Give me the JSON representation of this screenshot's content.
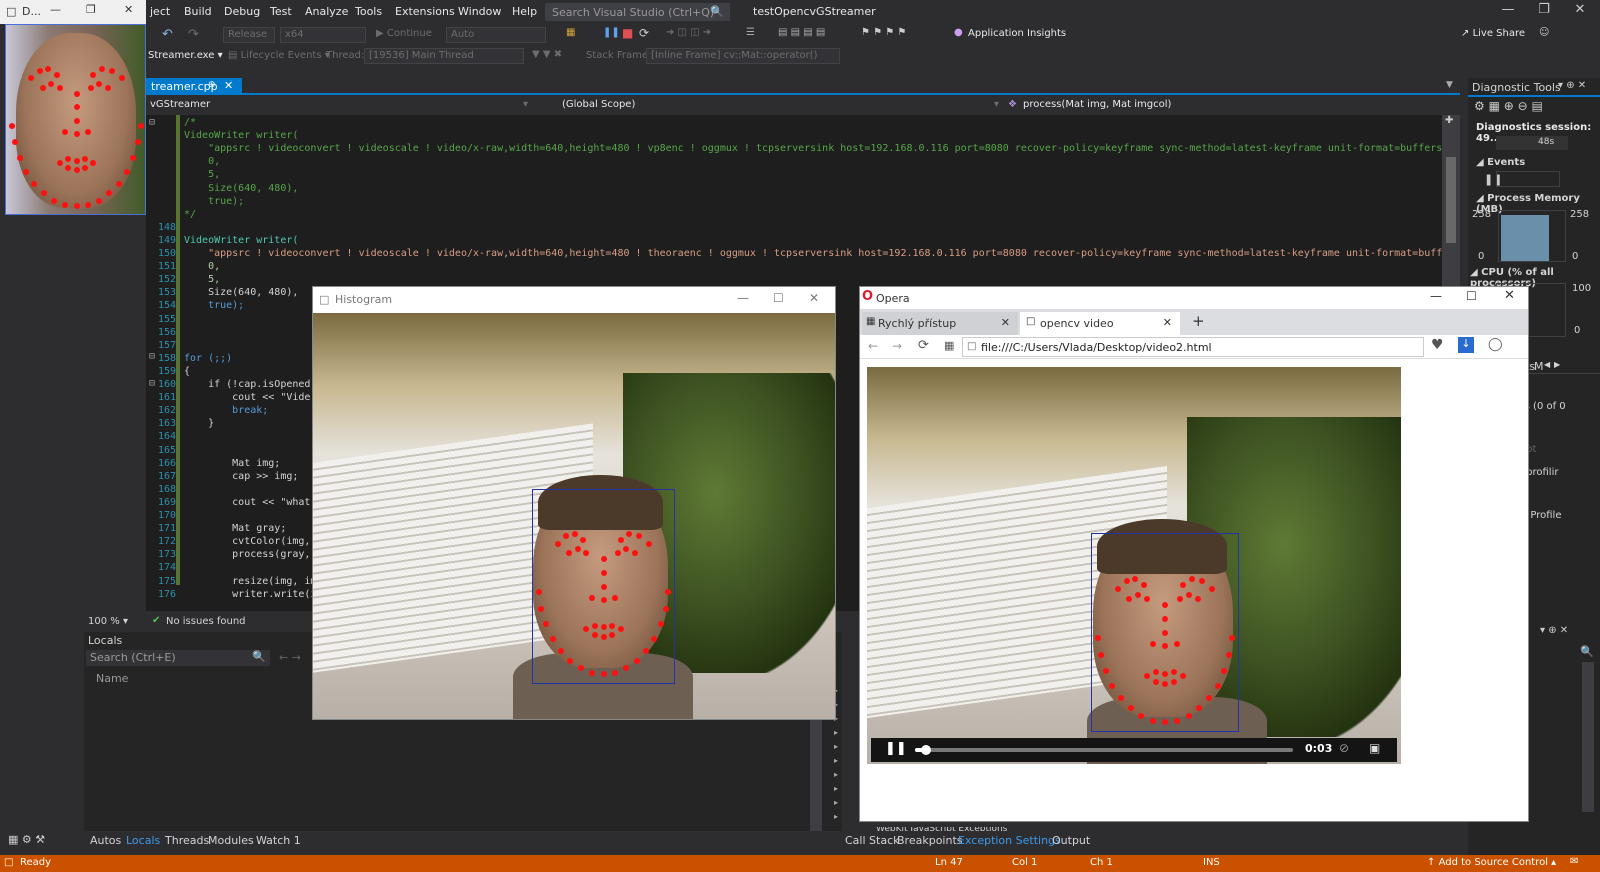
{
  "titlebar": {
    "menu": [
      "ject",
      "Build",
      "Debug",
      "Test",
      "Analyze",
      "Tools",
      "Extensions",
      "Window",
      "Help"
    ],
    "search_placeholder": "Search Visual Studio (Ctrl+Q)",
    "project": "testOpencvGStreamer"
  },
  "thumbnail": {
    "title": "D..."
  },
  "toolbar": {
    "config": "Release",
    "platform": "x64",
    "continue": "Continue",
    "auto": "Auto",
    "insights": "Application Insights",
    "liveshare": "Live Share"
  },
  "debugbar": {
    "process": "Streamer.exe",
    "lifecycle": "Lifecycle Events",
    "thread_label": "Thread:",
    "thread": "[19536] Main Thread",
    "stackframe_label": "Stack Frame:",
    "stackframe": "[Inline Frame] cv::Mat::operator()"
  },
  "editor": {
    "file_tab": "treamer.cpp",
    "nav_project": "vGStreamer",
    "nav_scope": "(Global Scope)",
    "nav_func": "process(Mat img, Mat imgcol)",
    "zoom": "100 %",
    "issues": "No issues found",
    "lines": [
      {
        "n": "",
        "t": "/*",
        "c": "cm"
      },
      {
        "n": "",
        "t": "VideoWriter writer(",
        "c": "cm"
      },
      {
        "n": "",
        "t": "    \"appsrc ! videoconvert ! videoscale ! video/x-raw,width=640,height=480 ! vp8enc ! oggmux ! tcpserversink host=192.168.0.116 port=8080 recover-policy=keyframe sync-method=latest-keyframe unit-format=buffers units",
        "c": "cm"
      },
      {
        "n": "",
        "t": "    0,",
        "c": "cm"
      },
      {
        "n": "",
        "t": "    5,",
        "c": "cm"
      },
      {
        "n": "",
        "t": "    Size(640, 480),",
        "c": "cm"
      },
      {
        "n": "",
        "t": "    true);",
        "c": "cm"
      },
      {
        "n": "",
        "t": "*/",
        "c": "cm"
      },
      {
        "n": "148",
        "t": "",
        "c": ""
      },
      {
        "n": "149",
        "t": "VideoWriter writer(",
        "c": "ty"
      },
      {
        "n": "150",
        "t": "    \"appsrc ! videoconvert ! videoscale ! video/x-raw,width=640,height=480 ! theoraenc ! oggmux ! tcpserversink host=192.168.0.116 port=8080 recover-policy=keyframe sync-method=latest-keyframe unit-format=buffers bu",
        "c": "str"
      },
      {
        "n": "151",
        "t": "    0,",
        "c": "num"
      },
      {
        "n": "152",
        "t": "    5,",
        "c": "num"
      },
      {
        "n": "153",
        "t": "    Size(640, 480),",
        "c": ""
      },
      {
        "n": "154",
        "t": "    true);",
        "c": "kw"
      },
      {
        "n": "155",
        "t": "",
        "c": ""
      },
      {
        "n": "156",
        "t": "",
        "c": ""
      },
      {
        "n": "157",
        "t": "",
        "c": ""
      },
      {
        "n": "158",
        "t": "for (;;)",
        "c": "kw"
      },
      {
        "n": "159",
        "t": "{",
        "c": ""
      },
      {
        "n": "160",
        "t": "    if (!cap.isOpened(",
        "c": ""
      },
      {
        "n": "161",
        "t": "        cout << \"Vide",
        "c": ""
      },
      {
        "n": "162",
        "t": "        break;",
        "c": "kw"
      },
      {
        "n": "163",
        "t": "    }",
        "c": ""
      },
      {
        "n": "164",
        "t": "",
        "c": ""
      },
      {
        "n": "165",
        "t": "",
        "c": ""
      },
      {
        "n": "166",
        "t": "        Mat img;",
        "c": ""
      },
      {
        "n": "167",
        "t": "        cap >> img;",
        "c": ""
      },
      {
        "n": "168",
        "t": "",
        "c": ""
      },
      {
        "n": "169",
        "t": "        cout << \"what\"",
        "c": ""
      },
      {
        "n": "170",
        "t": "",
        "c": ""
      },
      {
        "n": "171",
        "t": "        Mat gray;",
        "c": ""
      },
      {
        "n": "172",
        "t": "        cvtColor(img,",
        "c": ""
      },
      {
        "n": "173",
        "t": "        process(gray,",
        "c": ""
      },
      {
        "n": "174",
        "t": "",
        "c": ""
      },
      {
        "n": "175",
        "t": "        resize(img, im",
        "c": ""
      },
      {
        "n": "176",
        "t": "        writer.write(i",
        "c": ""
      }
    ]
  },
  "locals": {
    "title": "Locals",
    "search_placeholder": "Search (Ctrl+E)",
    "col_name": "Name"
  },
  "bottom_tabs_left": [
    "Autos",
    "Locals",
    "Threads",
    "Modules",
    "Watch 1"
  ],
  "bottom_tabs_right": [
    "Call Stack",
    "Breakpoints",
    "Exception Settings",
    "Output"
  ],
  "bottom_hidden_text": "WebKit JavaScript Exceptions",
  "status": {
    "ready": "Ready",
    "ln": "Ln 47",
    "col": "Col 1",
    "ch": "Ch 1",
    "ins": "INS",
    "source": "Add to Source Control"
  },
  "diagnostics": {
    "title": "Diagnostic Tools",
    "session": "Diagnostics session: 49...",
    "timeline": "48s",
    "events": "Events",
    "memory": "Process Memory (MB)",
    "mem_max": "258",
    "mem_min": "0",
    "cpu": "CPU (% of all processors)",
    "cpu_max": "100",
    "cpu_min": "0",
    "tab_events": "Events",
    "tab_m": "M",
    "events_count": "Events (0 of 0",
    "usage": "age",
    "snapshot": "napshot",
    "heap": "heap profilir",
    "cpu_profile": "CPU Profile"
  },
  "histogram": {
    "title": "Histogram"
  },
  "opera": {
    "title": "Opera",
    "tab1": "Rychlý přístup",
    "tab2": "opencv video",
    "url": "file:///C:/Users/Vlada/Desktop/video2.html",
    "time": "0:03"
  },
  "colors": {
    "accent": "#007acc",
    "status": "#ca5100",
    "landmark": "#ff1010"
  }
}
